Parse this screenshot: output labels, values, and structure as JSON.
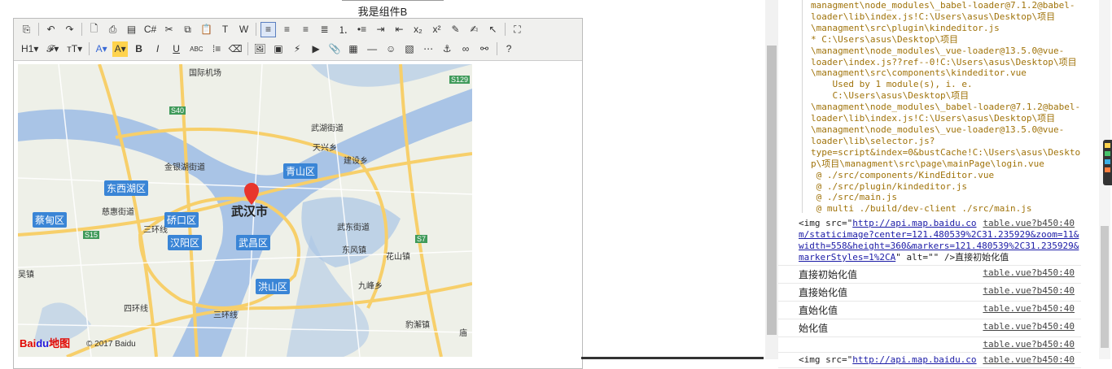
{
  "page": {
    "title": "我是组件B"
  },
  "toolbar": {
    "row1": [
      {
        "name": "source-icon",
        "glyph": "⎘"
      },
      {
        "sep": true
      },
      {
        "name": "undo-icon",
        "glyph": "↶"
      },
      {
        "name": "redo-icon",
        "glyph": "↷"
      },
      {
        "sep": true
      },
      {
        "name": "preview-icon",
        "glyph": "🗋"
      },
      {
        "name": "print-icon",
        "glyph": "⎙"
      },
      {
        "name": "template-icon",
        "glyph": "▤"
      },
      {
        "name": "code-icon",
        "glyph": "C#"
      },
      {
        "name": "cut-icon",
        "glyph": "✂"
      },
      {
        "name": "copy-icon",
        "glyph": "⧉"
      },
      {
        "name": "paste-icon",
        "glyph": "📋"
      },
      {
        "name": "plainpaste-icon",
        "glyph": "T"
      },
      {
        "name": "wordpaste-icon",
        "glyph": "W"
      },
      {
        "sep": true
      },
      {
        "name": "justifyleft-icon",
        "glyph": "≡",
        "active": true
      },
      {
        "name": "justifycenter-icon",
        "glyph": "≡"
      },
      {
        "name": "justifyright-icon",
        "glyph": "≡"
      },
      {
        "name": "justifyfull-icon",
        "glyph": "≣"
      },
      {
        "name": "orderedlist-icon",
        "glyph": "⒈"
      },
      {
        "name": "unorderedlist-icon",
        "glyph": "•≡"
      },
      {
        "name": "indent-icon",
        "glyph": "⇥"
      },
      {
        "name": "outdent-icon",
        "glyph": "⇤"
      },
      {
        "name": "subscript-icon",
        "glyph": "x₂"
      },
      {
        "name": "superscript-icon",
        "glyph": "x²"
      },
      {
        "name": "clearhtml-icon",
        "glyph": "✎"
      },
      {
        "name": "quickformat-icon",
        "glyph": "✍"
      },
      {
        "name": "selectall-icon",
        "glyph": "↖"
      },
      {
        "sep": true
      },
      {
        "name": "fullscreen-icon",
        "glyph": "⛶"
      }
    ],
    "row2": [
      {
        "name": "heading-icon",
        "glyph": "H1▾"
      },
      {
        "name": "fontname-icon",
        "glyph": "𝓕▾"
      },
      {
        "name": "fontsize-icon",
        "glyph": "тT▾"
      },
      {
        "sep": true
      },
      {
        "name": "forecolor-icon",
        "glyph": "A▾"
      },
      {
        "name": "hilitecolor-icon",
        "glyph": "A▾"
      },
      {
        "name": "bold-icon",
        "glyph": "B"
      },
      {
        "name": "italic-icon",
        "glyph": "I"
      },
      {
        "name": "underline-icon",
        "glyph": "U"
      },
      {
        "name": "strikethrough-icon",
        "glyph": "ABC"
      },
      {
        "name": "lineheight-icon",
        "glyph": "⁞≡"
      },
      {
        "name": "removeformat-icon",
        "glyph": "⌫"
      },
      {
        "sep": true
      },
      {
        "name": "image-icon",
        "glyph": "🖼"
      },
      {
        "name": "multiimage-icon",
        "glyph": "▣"
      },
      {
        "name": "flash-icon",
        "glyph": "⚡"
      },
      {
        "name": "media-icon",
        "glyph": "▶"
      },
      {
        "name": "insertfile-icon",
        "glyph": "📎"
      },
      {
        "name": "table-icon",
        "glyph": "▦"
      },
      {
        "name": "hr-icon",
        "glyph": "―"
      },
      {
        "name": "emoticons-icon",
        "glyph": "☺"
      },
      {
        "name": "baidumap-icon",
        "glyph": "▧"
      },
      {
        "name": "pagebreak-icon",
        "glyph": "⋯"
      },
      {
        "name": "anchor-icon",
        "glyph": "⚓"
      },
      {
        "name": "link-icon",
        "glyph": "∞"
      },
      {
        "name": "unlink-icon",
        "glyph": "⚯"
      },
      {
        "sep": true
      },
      {
        "name": "about-icon",
        "glyph": "?"
      }
    ]
  },
  "map": {
    "labels": [
      {
        "t": "国际机场"
      },
      {
        "t": "S40"
      },
      {
        "t": "S129"
      },
      {
        "t": "武湖街道"
      },
      {
        "t": "天兴乡"
      },
      {
        "t": "建设乡"
      },
      {
        "t": "金银湖街道"
      },
      {
        "t": "慈惠街道"
      },
      {
        "t": "三环线"
      },
      {
        "t": "S15"
      },
      {
        "t": "武东街道"
      },
      {
        "t": "东风镇"
      },
      {
        "t": "花山镇"
      },
      {
        "t": "S7"
      },
      {
        "t": "九峰乡"
      },
      {
        "t": "四环线"
      },
      {
        "t": "三环线"
      },
      {
        "t": "豹澥镇"
      },
      {
        "t": "庙"
      },
      {
        "t": "吴镇"
      }
    ],
    "districts": [
      {
        "t": "东西湖区"
      },
      {
        "t": "蔡甸区"
      },
      {
        "t": "硚口区"
      },
      {
        "t": "汉阳区"
      },
      {
        "t": "武昌区"
      },
      {
        "t": "青山区"
      },
      {
        "t": "洪山区"
      }
    ],
    "city": "武汉市",
    "logo_bai": "Bai",
    "logo_du": "du",
    "logo_map": "地图",
    "copyright": "© 2017 Baidu"
  },
  "code_lines": [
    "managment\\node_modules\\_babel-loader@7.1.2@babel-",
    "loader\\lib\\index.js!C:\\Users\\asus\\Desktop\\项目",
    "\\managment\\src\\plugin\\kindeditor.js",
    "* C:\\Users\\asus\\Desktop\\项目",
    "\\managment\\node_modules\\_vue-loader@13.5.0@vue-",
    "loader\\index.js??ref--0!C:\\Users\\asus\\Desktop\\项目",
    "\\managment\\src\\components\\kindeditor.vue",
    "    Used by 1 module(s), i. e.",
    "    C:\\Users\\asus\\Desktop\\项目",
    "\\managment\\node_modules\\_babel-loader@7.1.2@babel-",
    "loader\\lib\\index.js!C:\\Users\\asus\\Desktop\\项目",
    "\\managment\\node_modules\\_vue-loader@13.5.0@vue-",
    "loader\\lib\\selector.js?",
    "type=script&index=0&bustCache!C:\\Users\\asus\\Deskto",
    "p\\项目\\managment\\src\\page\\mainPage\\login.vue",
    " @ ./src/components/KindEditor.vue",
    " @ ./src/plugin/kindeditor.js",
    " @ ./src/main.js",
    " @ multi ./build/dev-client ./src/main.js"
  ],
  "console": {
    "img_prefix": "<img src=\"",
    "img_url_1": "http://api.map.baidu.co",
    "img_url_2": "m/staticimage?center=121.480539%2C31.235929&zoom=11&",
    "img_url_3": "width=558&height=360&markers=121.480539%2C31.235929&",
    "img_url_4": "markerStyles=1%2CA",
    "img_suffix": "\" alt=\"\" />直接初始化值",
    "src": "table.vue?b450:40",
    "rows": [
      {
        "text": "直接初始化值",
        "src": "table.vue?b450:40"
      },
      {
        "text": "直接始化值",
        "src": "table.vue?b450:40"
      },
      {
        "text": "直始化值",
        "src": "table.vue?b450:40"
      },
      {
        "text": "始化值",
        "src": "table.vue?b450:40"
      },
      {
        "text": "",
        "src": "table.vue?b450:40"
      }
    ],
    "last_prefix": "<img src=\"",
    "last_url": "http://api.map.baidu.co",
    "last_src": "table.vue?b450:40"
  },
  "colors": {
    "river": "#a9c4e6",
    "road": "#f7cf6a",
    "district": "#3a85d6",
    "marker": "#e8352c",
    "code": "#a0730a"
  }
}
